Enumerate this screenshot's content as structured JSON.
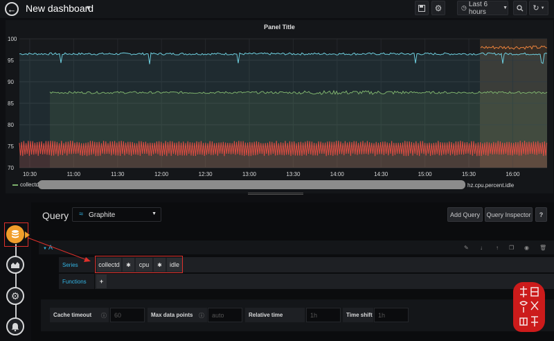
{
  "nav": {
    "title": "New dashboard",
    "time_range": "Last 6 hours"
  },
  "panel": {
    "title": "Panel Title",
    "legend_left": "collectd",
    "legend_right": "hz.cpu.percent.idle"
  },
  "chart_data": {
    "type": "line",
    "ylim": [
      70,
      100
    ],
    "y_ticks": [
      "100",
      "95",
      "90",
      "85",
      "80",
      "75",
      "70"
    ],
    "x_ticks": [
      "10:30",
      "11:00",
      "11:30",
      "12:00",
      "12:30",
      "13:00",
      "13:30",
      "14:00",
      "14:30",
      "15:00",
      "15:30",
      "16:00"
    ],
    "grid": true,
    "series": [
      {
        "color": "#6ed0e0",
        "approx_value": 96.5
      },
      {
        "color": "#7eb26d",
        "approx_value": 87.5
      },
      {
        "color": "#e24d42",
        "approx_value": 74.5
      },
      {
        "color": "#ef843c",
        "approx_value": 98
      }
    ]
  },
  "editor": {
    "query_label": "Query",
    "datasource": "Graphite",
    "add_query": "Add Query",
    "query_inspector": "Query Inspector",
    "help": "?",
    "row_label": "A",
    "series_label": "Series",
    "functions_label": "Functions",
    "add_function": "+",
    "segments": [
      "collectd",
      "✱",
      "cpu",
      "✱",
      "idle"
    ],
    "options": {
      "cache_timeout_label": "Cache timeout",
      "cache_timeout_placeholder": "60",
      "max_points_label": "Max data points",
      "max_points_placeholder": "auto",
      "relative_time_label": "Relative time",
      "relative_time_placeholder": "1h",
      "time_shift_label": "Time shift",
      "time_shift_placeholder": "1h"
    }
  },
  "colors": {
    "accent": "#33b5e5",
    "highlight_box": "#e0302b",
    "datasource_icon": "#f19e2b"
  },
  "icons": [
    "arrow-left-icon",
    "save-icon",
    "gear-icon",
    "clock-icon",
    "search-icon",
    "refresh-icon",
    "database-icon",
    "chart-icon",
    "cog-icon",
    "bell-icon",
    "pencil-icon",
    "arrow-down-icon",
    "arrow-up-icon",
    "copy-icon",
    "eye-icon",
    "trash-icon"
  ]
}
